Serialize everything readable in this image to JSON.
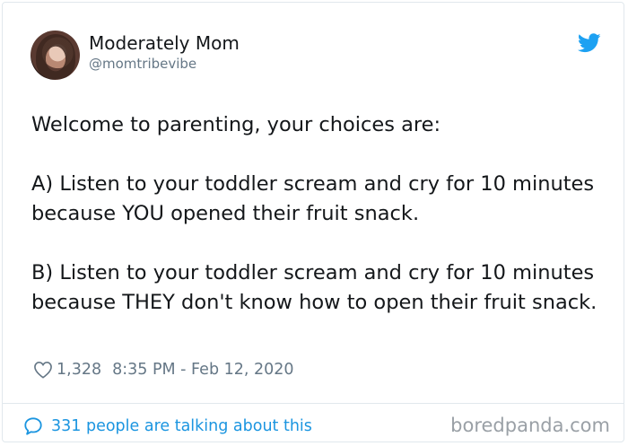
{
  "author": {
    "display_name": "Moderately Mom",
    "handle": "@momtribevibe"
  },
  "tweet": {
    "text": "Welcome to parenting, your choices are:\n\nA) Listen to your toddler scream and cry for 10 minutes because YOU opened their fruit snack.\n\nB) Listen to your toddler scream and cry for 10 minutes because THEY don't know how to open their fruit snack.",
    "likes": "1,328",
    "timestamp": "8:35 PM - Feb 12, 2020"
  },
  "footer": {
    "conversation_text": "331 people are talking about this",
    "watermark": "boredpanda.com"
  },
  "icons": {
    "brand": "twitter-bird-icon",
    "like": "heart-icon",
    "reply": "speech-bubble-icon"
  },
  "colors": {
    "twitter_blue": "#1da1f2",
    "link_blue": "#1b95e0",
    "text_primary": "#14171a",
    "text_secondary": "#657786",
    "border": "#e1e8ed"
  }
}
